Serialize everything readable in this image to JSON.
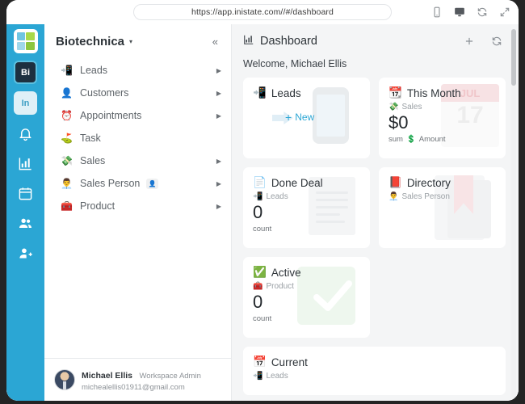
{
  "browser": {
    "url": "https://app.inistate.com//#/dashboard",
    "icons": [
      {
        "name": "mobile-view-icon",
        "active": false
      },
      {
        "name": "desktop-view-icon",
        "active": true
      },
      {
        "name": "reload-icon",
        "active": false
      },
      {
        "name": "expand-icon",
        "active": false
      }
    ]
  },
  "rail": {
    "logo": "app-logo",
    "badges": [
      {
        "label": "Bi",
        "name": "workspace-badge-bi"
      },
      {
        "label": "In",
        "name": "workspace-badge-in"
      }
    ],
    "icons": [
      "bell-icon",
      "chart-icon",
      "calendar-icon",
      "people-icon",
      "add-person-icon"
    ]
  },
  "sidebar": {
    "workspace": "Biotechnica",
    "caret": "▾",
    "collapse": "«",
    "items": [
      {
        "label": "Leads",
        "icon": "📲",
        "chevron": true,
        "badge": null
      },
      {
        "label": "Customers",
        "icon": "👤",
        "chevron": true,
        "badge": null
      },
      {
        "label": "Appointments",
        "icon": "⏰",
        "chevron": true,
        "badge": null
      },
      {
        "label": "Task",
        "icon": "⛳",
        "chevron": false,
        "badge": null
      },
      {
        "label": "Sales",
        "icon": "💸",
        "chevron": true,
        "badge": null
      },
      {
        "label": "Sales Person",
        "icon": "👨‍💼",
        "chevron": true,
        "badge": "👤"
      },
      {
        "label": "Product",
        "icon": "🧰",
        "chevron": true,
        "badge": null
      }
    ],
    "user": {
      "name": "Michael Ellis",
      "role": "Workspace Admin",
      "email": "michealellis01911@gmail.com"
    }
  },
  "main": {
    "title": "Dashboard",
    "title_icon": "chart-icon",
    "welcome": "Welcome, Michael Ellis",
    "actions": [
      "add-icon",
      "refresh-icon"
    ],
    "cards": [
      {
        "title": "Leads",
        "title_icon": "📲",
        "button": "New",
        "button_plus": "+"
      },
      {
        "title": "This Month",
        "title_icon": "📆",
        "sub": "Sales",
        "sub_icon": "💸",
        "value": "$0",
        "foot": "sum",
        "foot_icon": "💲",
        "foot_label": "Amount",
        "wm_month": "JUL",
        "wm_day": "17"
      },
      {
        "title": "Done Deal",
        "title_icon": "📄",
        "sub": "Leads",
        "sub_icon": "📲",
        "value": "0",
        "foot": "count"
      },
      {
        "title": "Directory",
        "title_icon": "📕",
        "sub": "Sales Person",
        "sub_icon": "👨‍💼"
      },
      {
        "title": "Active",
        "title_icon": "✅",
        "sub": "Product",
        "sub_icon": "🧰",
        "value": "0",
        "foot": "count"
      },
      {
        "title": "Current",
        "title_icon": "📅",
        "sub": "Leads",
        "sub_icon": "📲"
      }
    ]
  },
  "colors": {
    "rail": "#2ba6d4",
    "accent": "#2ba6d4",
    "bg": "#f4f5f6",
    "card": "#ffffff"
  }
}
